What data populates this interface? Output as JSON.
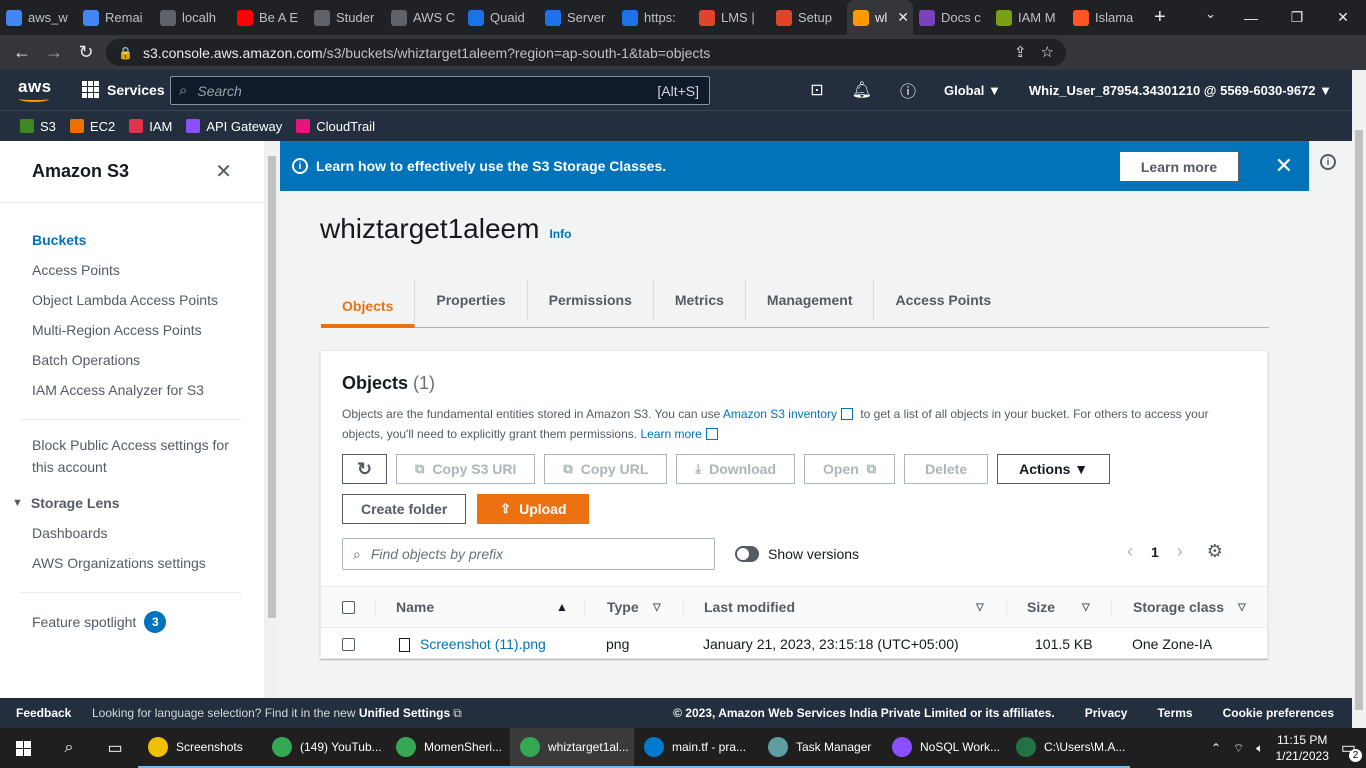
{
  "browser": {
    "tabs": [
      {
        "title": "aws_w",
        "color": "#4285f4"
      },
      {
        "title": "Remai",
        "color": "#4285f4"
      },
      {
        "title": "localh",
        "color": "#5f6368"
      },
      {
        "title": "Be A E",
        "color": "#ff0000"
      },
      {
        "title": "Studer",
        "color": "#5f6368"
      },
      {
        "title": "AWS C",
        "color": "#5f6368"
      },
      {
        "title": "Quaid",
        "color": "#1a73e8"
      },
      {
        "title": "Server",
        "color": "#1a73e8"
      },
      {
        "title": "https:",
        "color": "#1a73e8"
      },
      {
        "title": "LMS |",
        "color": "#e0452b"
      },
      {
        "title": "Setup",
        "color": "#e0452b"
      },
      {
        "title": "wl",
        "color": "#ff9900",
        "active": true
      },
      {
        "title": "Docs c",
        "color": "#7b42bc"
      },
      {
        "title": "IAM M",
        "color": "#7aa116"
      },
      {
        "title": "Islama",
        "color": "#ff5722"
      }
    ],
    "url_host": "s3.console.aws.amazon.com",
    "url_path": "/s3/buckets/whiztarget1aleem?region=ap-south-1&tab=objects"
  },
  "aws_header": {
    "logo": "aws",
    "services_label": "Services",
    "search_placeholder": "Search",
    "search_shortcut": "[Alt+S]",
    "region": "Global ▼",
    "account": "Whiz_User_87954.34301210 @ 5569-6030-9672 ▼"
  },
  "favorites": [
    {
      "label": "S3",
      "color": "#3f8624"
    },
    {
      "label": "EC2",
      "color": "#ed7100"
    },
    {
      "label": "IAM",
      "color": "#dd344c"
    },
    {
      "label": "API Gateway",
      "color": "#8c4fff"
    },
    {
      "label": "CloudTrail",
      "color": "#e7157b"
    }
  ],
  "sidenav": {
    "title": "Amazon S3",
    "items": [
      "Buckets",
      "Access Points",
      "Object Lambda Access Points",
      "Multi-Region Access Points",
      "Batch Operations",
      "IAM Access Analyzer for S3"
    ],
    "block_public": "Block Public Access settings for this account",
    "storage_lens": "Storage Lens",
    "storage_lens_items": [
      "Dashboards",
      "AWS Organizations settings"
    ],
    "feature_spotlight": "Feature spotlight",
    "feature_count": "3"
  },
  "flashbar": {
    "icon": "i",
    "message": "Learn how to effectively use the S3 Storage Classes.",
    "button": "Learn more"
  },
  "bucket": {
    "name": "whiztarget1aleem",
    "info": "Info",
    "tabs": [
      "Objects",
      "Properties",
      "Permissions",
      "Metrics",
      "Management",
      "Access Points"
    ]
  },
  "objects": {
    "heading": "Objects",
    "count": "(1)",
    "desc_1": "Objects are the fundamental entities stored in Amazon S3. You can use ",
    "desc_link_1": "Amazon S3 inventory",
    "desc_2": " to get a list of all objects in your bucket. For others to access your objects, you'll need to explicitly grant them permissions. ",
    "desc_link_2": "Learn more",
    "buttons": {
      "copy_uri": "Copy S3 URI",
      "copy_url": "Copy URL",
      "download": "Download",
      "open": "Open",
      "delete": "Delete",
      "actions": "Actions ▼",
      "create_folder": "Create folder",
      "upload": "Upload"
    },
    "search_placeholder": "Find objects by prefix",
    "show_versions": "Show versions",
    "page": "1",
    "columns": [
      "Name",
      "Type",
      "Last modified",
      "Size",
      "Storage class"
    ],
    "rows": [
      {
        "name": "Screenshot (11).png",
        "type": "png",
        "modified": "January 21, 2023, 23:15:18 (UTC+05:00)",
        "size": "101.5 KB",
        "storage_class": "One Zone-IA"
      }
    ]
  },
  "footer": {
    "feedback": "Feedback",
    "lang_text": "Looking for language selection? Find it in the new ",
    "lang_link": "Unified Settings",
    "copyright": "© 2023, Amazon Web Services India Private Limited or its affiliates.",
    "links": [
      "Privacy",
      "Terms",
      "Cookie preferences"
    ]
  },
  "taskbar": {
    "apps": [
      {
        "label": "Screenshots",
        "color": "#f0c000"
      },
      {
        "label": "(149) YouTub...",
        "color": "#34a853"
      },
      {
        "label": "MomenSheri...",
        "color": "#34a853"
      },
      {
        "label": "whiztarget1al...",
        "color": "#34a853",
        "active": true
      },
      {
        "label": "main.tf - pra...",
        "color": "#007acc"
      },
      {
        "label": "Task Manager",
        "color": "#5f9ea0"
      },
      {
        "label": "NoSQL Work...",
        "color": "#8c4fff"
      },
      {
        "label": "C:\\Users\\M.A...",
        "color": "#217346"
      }
    ],
    "time": "11:15 PM",
    "date": "1/21/2023",
    "notifications": "2"
  }
}
